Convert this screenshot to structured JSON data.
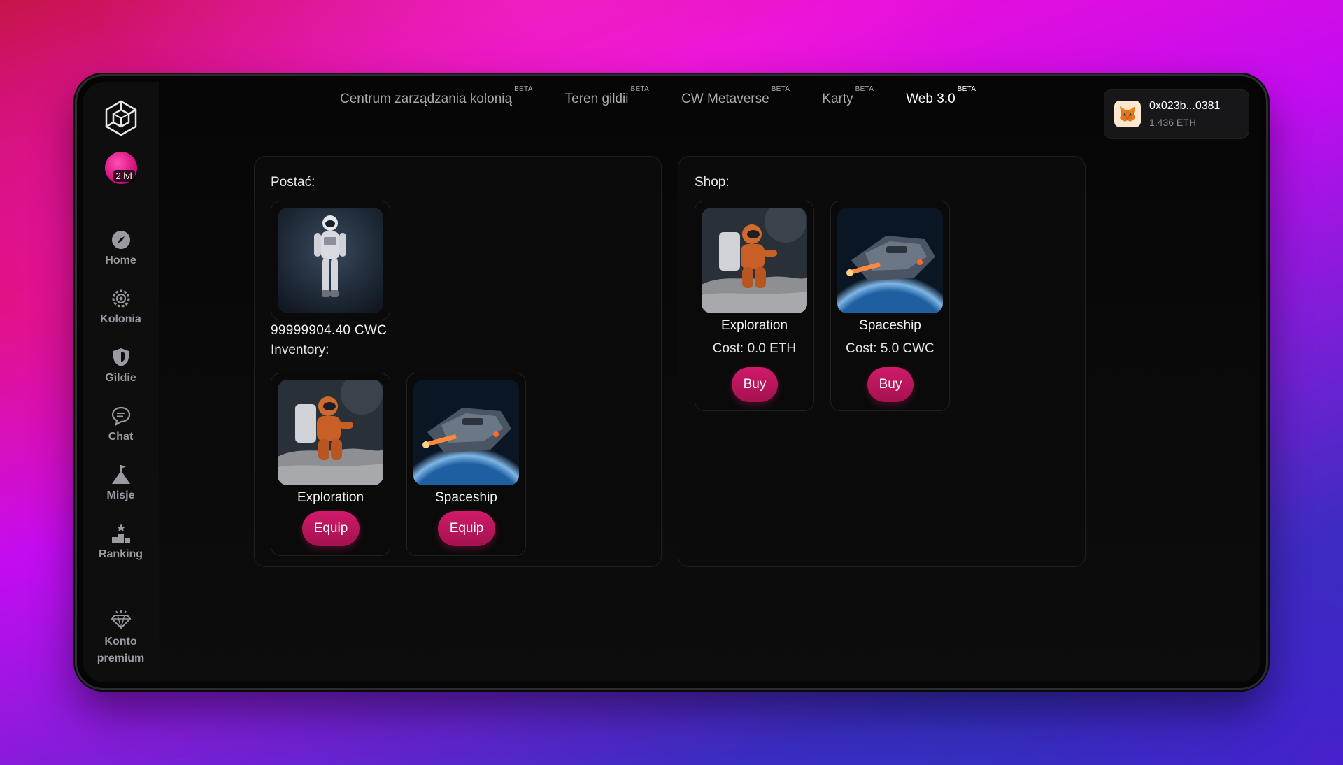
{
  "tabs": [
    {
      "label": "Centrum zarządzania kolonią",
      "badge": "BETA"
    },
    {
      "label": "Teren gildii",
      "badge": "BETA"
    },
    {
      "label": "CW Metaverse",
      "badge": "BETA"
    },
    {
      "label": "Karty",
      "badge": "BETA"
    },
    {
      "label": "Web 3.0",
      "badge": "BETA"
    }
  ],
  "active_tab": "Web 3.0",
  "user": {
    "level": "2 lvl"
  },
  "wallet": {
    "address": "0x023b...0381",
    "balance": "1.436 ETH",
    "icon": "metamask-fox-icon"
  },
  "sidebar": {
    "items": [
      {
        "label": "Home",
        "icon": "compass-icon"
      },
      {
        "label": "Kolonia",
        "icon": "colony-gear-icon"
      },
      {
        "label": "Gildie",
        "icon": "shield-icon"
      },
      {
        "label": "Chat",
        "icon": "chat-bubbles-icon"
      },
      {
        "label": "Misje",
        "icon": "mountain-flag-icon"
      },
      {
        "label": "Ranking",
        "icon": "podium-icon"
      }
    ],
    "premium": {
      "line1": "Konto",
      "line2": "premium",
      "icon": "diamond-icon"
    }
  },
  "character": {
    "title": "Postać:",
    "balance": "99999904.40 CWC",
    "inventory_title": "Inventory:",
    "inventory": [
      {
        "name": "Exploration",
        "button": "Equip"
      },
      {
        "name": "Spaceship",
        "button": "Equip"
      }
    ]
  },
  "shop": {
    "title": "Shop:",
    "items": [
      {
        "name": "Exploration",
        "cost": "Cost: 0.0 ETH",
        "button": "Buy"
      },
      {
        "name": "Spaceship",
        "cost": "Cost: 5.0 CWC",
        "button": "Buy"
      }
    ]
  },
  "colors": {
    "accent": "#c3165f",
    "background": "#0b0b0c"
  }
}
